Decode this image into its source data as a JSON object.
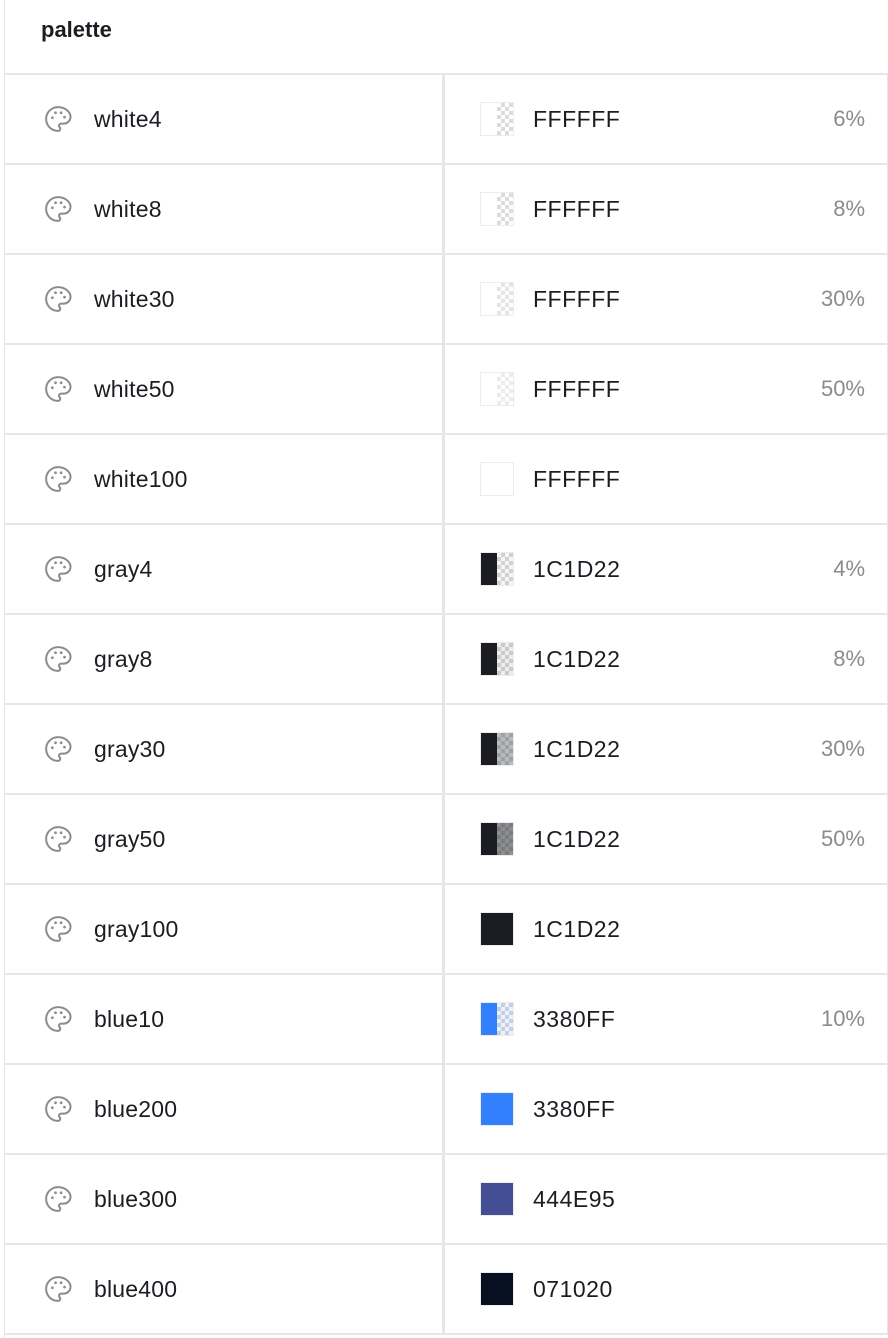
{
  "header": {
    "title": "palette"
  },
  "rows": [
    {
      "name": "white4",
      "hex": "FFFFFF",
      "color": "#FFFFFF",
      "opacity_label": "6%",
      "opacity": 0.06
    },
    {
      "name": "white8",
      "hex": "FFFFFF",
      "color": "#FFFFFF",
      "opacity_label": "8%",
      "opacity": 0.08
    },
    {
      "name": "white30",
      "hex": "FFFFFF",
      "color": "#FFFFFF",
      "opacity_label": "30%",
      "opacity": 0.3
    },
    {
      "name": "white50",
      "hex": "FFFFFF",
      "color": "#FFFFFF",
      "opacity_label": "50%",
      "opacity": 0.5
    },
    {
      "name": "white100",
      "hex": "FFFFFF",
      "color": "#FFFFFF",
      "opacity_label": "",
      "opacity": 1.0
    },
    {
      "name": "gray4",
      "hex": "1C1D22",
      "color": "#1C1D22",
      "opacity_label": "4%",
      "opacity": 0.04
    },
    {
      "name": "gray8",
      "hex": "1C1D22",
      "color": "#1C1D22",
      "opacity_label": "8%",
      "opacity": 0.08
    },
    {
      "name": "gray30",
      "hex": "1C1D22",
      "color": "#1C1D22",
      "opacity_label": "30%",
      "opacity": 0.3
    },
    {
      "name": "gray50",
      "hex": "1C1D22",
      "color": "#1C1D22",
      "opacity_label": "50%",
      "opacity": 0.5
    },
    {
      "name": "gray100",
      "hex": "1C1D22",
      "color": "#1C1D22",
      "opacity_label": "",
      "opacity": 1.0
    },
    {
      "name": "blue10",
      "hex": "3380FF",
      "color": "#3380FF",
      "opacity_label": "10%",
      "opacity": 0.1
    },
    {
      "name": "blue200",
      "hex": "3380FF",
      "color": "#3380FF",
      "opacity_label": "",
      "opacity": 1.0
    },
    {
      "name": "blue300",
      "hex": "444E95",
      "color": "#444E95",
      "opacity_label": "",
      "opacity": 1.0
    },
    {
      "name": "blue400",
      "hex": "071020",
      "color": "#071020",
      "opacity_label": "",
      "opacity": 1.0
    }
  ],
  "icons": {
    "row_icon": "palette-icon"
  }
}
